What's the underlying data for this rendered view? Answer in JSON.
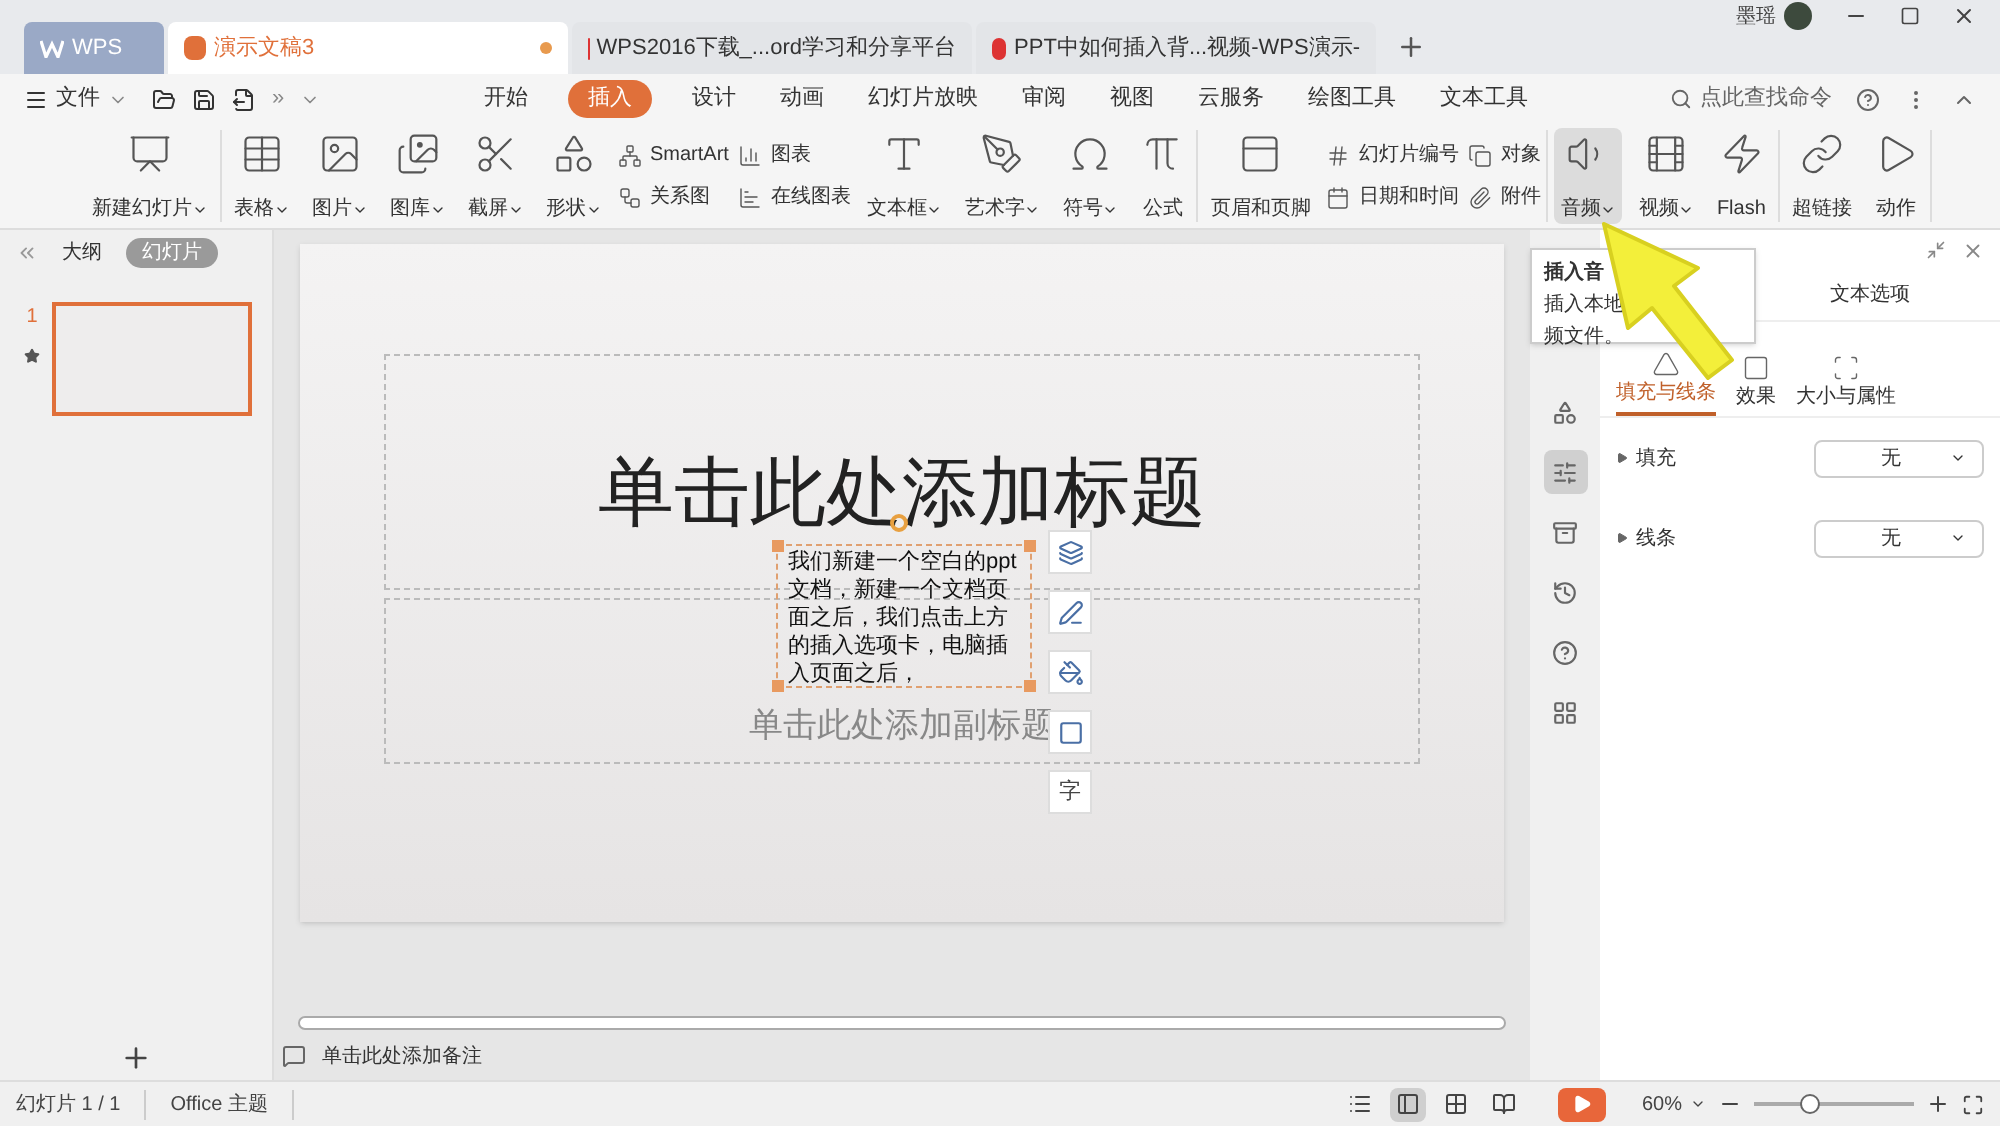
{
  "tabs": [
    {
      "label": "WPS",
      "selected": false,
      "kind": "home",
      "modified": false
    },
    {
      "label": "演示文稿3",
      "selected": true,
      "kind": "doc",
      "modified": true
    },
    {
      "label": "WPS2016下载_...ord学习和分享平台",
      "selected": false,
      "kind": "web",
      "modified": false
    },
    {
      "label": "PPT中如何插入背...视频-WPS演示-",
      "selected": false,
      "kind": "web",
      "modified": false
    }
  ],
  "user": {
    "name": "墨瑶"
  },
  "menu": {
    "file": "文件",
    "more": "»",
    "search": "点此查找命令",
    "ribbon_tabs": [
      {
        "label": "开始",
        "selected": false
      },
      {
        "label": "插入",
        "selected": true
      },
      {
        "label": "设计",
        "selected": false
      },
      {
        "label": "动画",
        "selected": false
      },
      {
        "label": "幻灯片放映",
        "selected": false
      },
      {
        "label": "审阅",
        "selected": false
      },
      {
        "label": "视图",
        "selected": false
      },
      {
        "label": "云服务",
        "selected": false
      },
      {
        "label": "绘图工具",
        "selected": false
      },
      {
        "label": "文本工具",
        "selected": false
      }
    ]
  },
  "ribbon": [
    [
      {
        "kind": "large",
        "label": "新建幻灯片",
        "dropdown": true,
        "active": false
      }
    ],
    [
      {
        "kind": "large",
        "label": "表格",
        "dropdown": true,
        "active": false
      },
      {
        "kind": "large",
        "label": "图片",
        "dropdown": true,
        "active": false
      },
      {
        "kind": "large",
        "label": "图库",
        "dropdown": true,
        "active": false
      },
      {
        "kind": "large",
        "label": "截屏",
        "dropdown": true,
        "active": false
      },
      {
        "kind": "large",
        "label": "形状",
        "dropdown": true,
        "active": false
      },
      {
        "kind": "stack",
        "items": [
          "SmartArt",
          "关系图"
        ]
      },
      {
        "kind": "stack",
        "items": [
          "图表",
          "在线图表"
        ]
      },
      {
        "kind": "large",
        "label": "文本框",
        "dropdown": true,
        "active": false
      },
      {
        "kind": "large",
        "label": "艺术字",
        "dropdown": true,
        "active": false
      },
      {
        "kind": "large",
        "label": "符号",
        "dropdown": true,
        "active": false
      },
      {
        "kind": "large",
        "label": "公式",
        "dropdown": false,
        "active": false
      }
    ],
    [
      {
        "kind": "large",
        "label": "页眉和页脚",
        "dropdown": false,
        "active": false
      },
      {
        "kind": "stack",
        "items": [
          "幻灯片编号",
          "日期和时间"
        ]
      },
      {
        "kind": "stack",
        "items": [
          "对象",
          "附件"
        ]
      }
    ],
    [
      {
        "kind": "large",
        "label": "音频",
        "dropdown": true,
        "active": true
      },
      {
        "kind": "large",
        "label": "视频",
        "dropdown": true,
        "active": false
      },
      {
        "kind": "large",
        "label": "Flash",
        "dropdown": false,
        "active": false
      }
    ],
    [
      {
        "kind": "large",
        "label": "超链接",
        "dropdown": false,
        "active": false
      },
      {
        "kind": "large",
        "label": "动作",
        "dropdown": false,
        "active": false
      }
    ]
  ],
  "left_panel": {
    "tabs": [
      {
        "label": "大纲",
        "selected": false
      },
      {
        "label": "幻灯片",
        "selected": true
      }
    ],
    "slides": [
      {
        "number": "1",
        "selected": true
      }
    ]
  },
  "slide": {
    "title": "单击此处添加标题",
    "subtitle": "单击此处添加副标题",
    "textbox": "我们新建一个空白的ppt文档，新建一个文档页面之后，我们点击上方的插入选项卡，电脑插入页面之后，",
    "text_tool": "字"
  },
  "notes": "单击此处添加备注",
  "tooltip": {
    "title": "插入音",
    "lines": [
      "插入本地",
      "频文件。"
    ]
  },
  "side_tools": [
    {
      "selected": false
    },
    {
      "selected": true
    },
    {
      "selected": false
    },
    {
      "selected": false
    },
    {
      "selected": false
    },
    {
      "selected": false
    }
  ],
  "panel": {
    "tab": "文本选项",
    "subtabs": [
      {
        "label": "填充与线条",
        "selected": true
      },
      {
        "label": "效果",
        "selected": false
      },
      {
        "label": "大小与属性",
        "selected": false
      }
    ],
    "properties": [
      {
        "label": "填充",
        "value": "无"
      },
      {
        "label": "线条",
        "value": "无"
      }
    ]
  },
  "status": {
    "slide": "幻灯片 1 / 1",
    "theme": "Office 主题",
    "zoom": "60%",
    "level": 0.35,
    "views": [
      {
        "selected": false
      },
      {
        "selected": true
      },
      {
        "selected": false
      },
      {
        "selected": false
      }
    ]
  }
}
